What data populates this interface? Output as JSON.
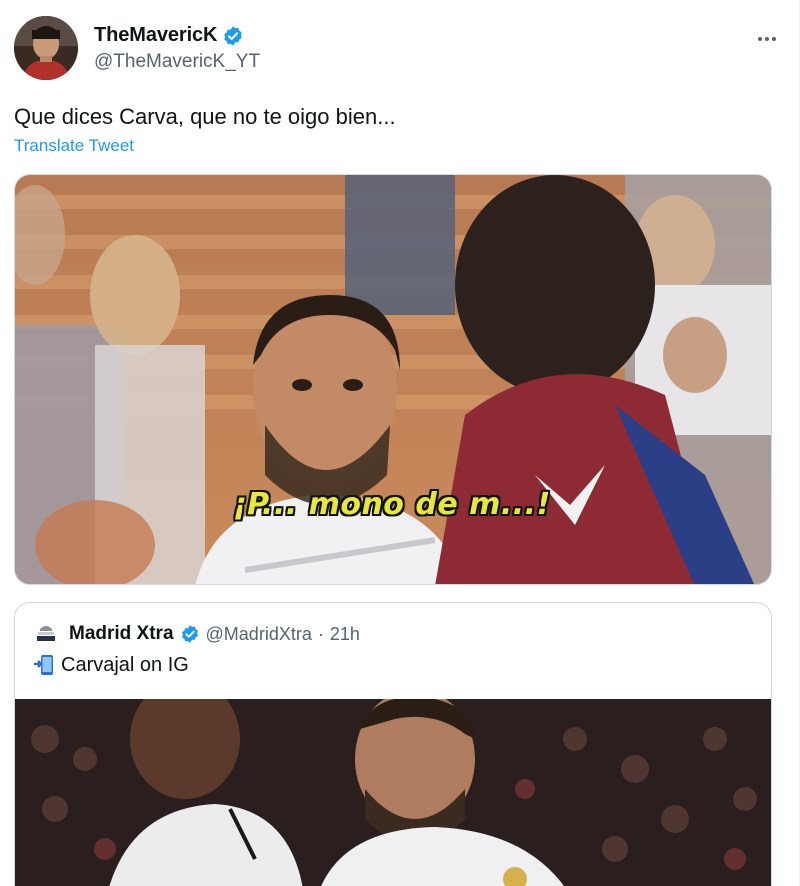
{
  "author": {
    "display_name": "TheMavericK",
    "handle": "@TheMavericK_YT",
    "verified": true
  },
  "tweet": {
    "text": "Que dices Carva, que no te oigo bien...",
    "translate_label": "Translate Tweet"
  },
  "media": {
    "caption": "¡P... mono de m...!"
  },
  "quoted_tweet": {
    "author_name": "Madrid Xtra",
    "author_handle": "@MadridXtra",
    "separator": "·",
    "time": "21h",
    "text": "Carvajal on IG",
    "emoji_icon": "mobile-phone-arrow-icon"
  },
  "colors": {
    "link": "#1d9bf0",
    "verified": "#1d9bf0",
    "secondary_text": "#536471",
    "border": "#cfd9de",
    "caption_yellow": "#e8e83a"
  }
}
